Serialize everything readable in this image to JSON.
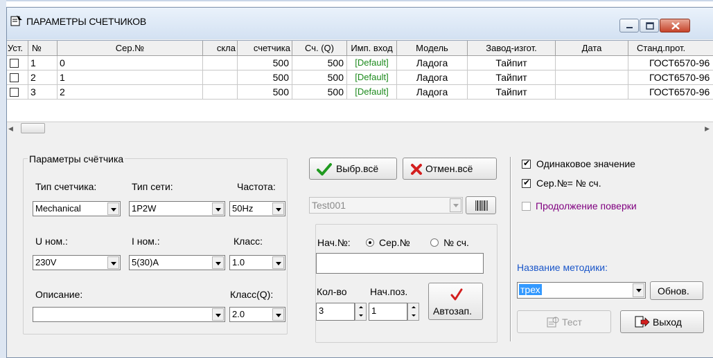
{
  "window": {
    "title": "ПАРАМЕТРЫ СЧЕТЧИКОВ"
  },
  "grid": {
    "headers": [
      "Уст.",
      "№",
      "Сер.№",
      "скла",
      "счетчика",
      "Сч. (Q)",
      "Имп. вход",
      "Модель",
      "Завод-изгот.",
      "Дата",
      "Станд.прот."
    ],
    "rows": [
      {
        "checked": false,
        "no": "1",
        "serial": "0",
        "sklad": "",
        "const": "500",
        "constq": "500",
        "imp": "[Default]",
        "model": "Ладога",
        "maker": "Тайпит",
        "date": "",
        "std": "ГОСТ6570-96"
      },
      {
        "checked": false,
        "no": "2",
        "serial": "1",
        "sklad": "",
        "const": "500",
        "constq": "500",
        "imp": "[Default]",
        "model": "Ладога",
        "maker": "Тайпит",
        "date": "",
        "std": "ГОСТ6570-96"
      },
      {
        "checked": false,
        "no": "3",
        "serial": "2",
        "sklad": "",
        "const": "500",
        "constq": "500",
        "imp": "[Default]",
        "model": "Ладога",
        "maker": "Тайпит",
        "date": "",
        "std": "ГОСТ6570-96"
      }
    ]
  },
  "params": {
    "group_title": "Параметры счётчика",
    "meter_type_label": "Тип счетчика:",
    "meter_type_value": "Mechanical",
    "net_type_label": "Тип сети:",
    "net_type_value": "1P2W",
    "freq_label": "Частота:",
    "freq_value": "50Hz",
    "unom_label": "U ном.:",
    "unom_value": "230V",
    "inom_label": "I ном.:",
    "inom_value": "5(30)A",
    "class_label": "Класс:",
    "class_value": "1.0",
    "desc_label": "Описание:",
    "desc_value": "",
    "classq_label": "Класс(Q):",
    "classq_value": "2.0"
  },
  "middle": {
    "select_all": "Выбр.всё",
    "cancel_all": "Отмен.всё",
    "template_value": "Test001",
    "start_no_label": "Нач.№:",
    "radio_serial": "Сер.№",
    "radio_meter": "№ сч.",
    "start_no_value": "",
    "count_label": "Кол-во",
    "start_pos_label": "Нач.поз.",
    "count_value": "3",
    "start_pos_value": "1",
    "autofill": "Автозап."
  },
  "right": {
    "same_value": "Одинаковое значение",
    "same_value_checked": true,
    "serial_eq": "Сер.№= № сч.",
    "serial_eq_checked": true,
    "continue": "Продолжение поверки",
    "continue_checked": false,
    "method_label": "Название методики:",
    "method_value": "трех",
    "refresh": "Обнов.",
    "test": "Тест",
    "exit": "Выход"
  },
  "colors": {
    "accent_blue": "#1a56c9",
    "continue_purple": "#800080",
    "default_green": "#1d8a1d"
  }
}
